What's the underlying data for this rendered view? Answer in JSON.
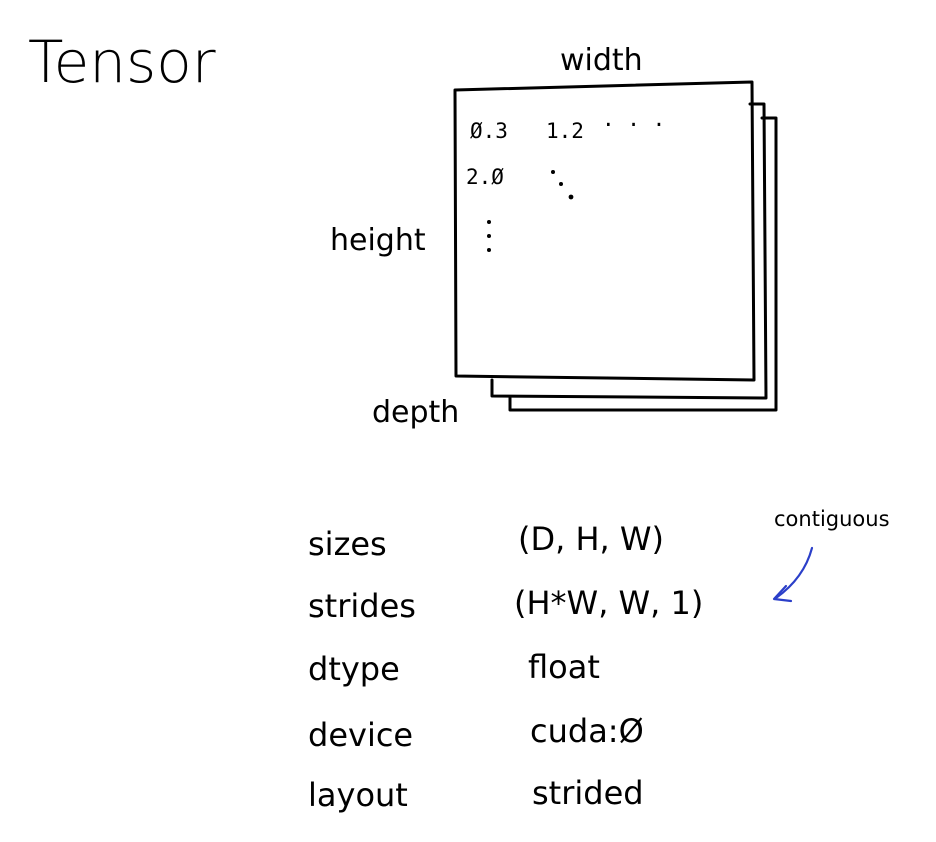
{
  "title": "Tensor",
  "axes": {
    "width": "width",
    "height": "height",
    "depth": "depth"
  },
  "cells": {
    "r0c0": "Ø.3",
    "r0c1": "1.2",
    "r0_hdots": "· · ·",
    "r1c0": "2.Ø"
  },
  "properties": [
    {
      "name": "sizes",
      "value": "(D, H, W)"
    },
    {
      "name": "strides",
      "value": "(H*W, W, 1)"
    },
    {
      "name": "dtype",
      "value": "float"
    },
    {
      "name": "device",
      "value": "cuda:Ø"
    },
    {
      "name": "layout",
      "value": "strided"
    }
  ],
  "annotation": {
    "text": "contiguous",
    "color": "#2b3fc9"
  }
}
